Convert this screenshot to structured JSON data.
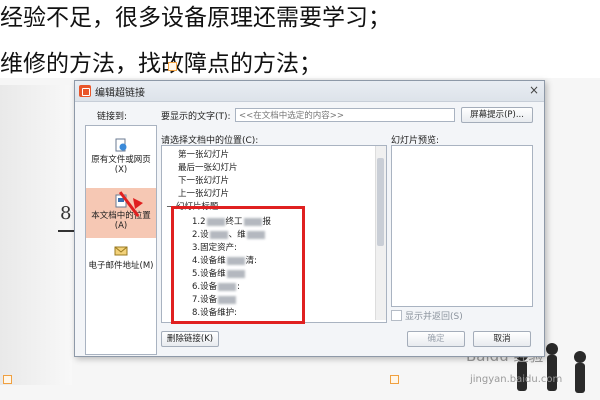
{
  "document": {
    "line1": "经验不足，很多设备原理还需要学习；",
    "line2": "维修的方法，找故障点的方法；",
    "slide_mark": "8"
  },
  "watermark": {
    "brand": "Baidu 经验",
    "url": "jingyan.baidu.com"
  },
  "dialog": {
    "title": "编辑超链接",
    "close_glyph": "×",
    "link_to_label": "链接到:",
    "display_text_label": "要显示的文字(T):",
    "display_text_value": "<<在文档中选定的内容>>",
    "screentip_button": "屏幕提示(P)...",
    "location_label": "请选择文档中的位置(C):",
    "preview_label": "幻灯片预览:",
    "show_return_label": "显示并返回(S)",
    "remove_link_button": "删除链接(K)",
    "ok_button": "确定",
    "cancel_button": "取消"
  },
  "leftnav": {
    "items": [
      {
        "label": "原有文件或网页(X)",
        "selected": false,
        "icon": "file-web-icon"
      },
      {
        "label": "本文档中的位置(A)",
        "selected": true,
        "icon": "document-location-icon"
      },
      {
        "label": "电子邮件地址(M)",
        "selected": false,
        "icon": "email-icon"
      }
    ]
  },
  "tree": {
    "items": [
      {
        "label": "第一张幻灯片"
      },
      {
        "label": "最后一张幻灯片"
      },
      {
        "label": "下一张幻灯片"
      },
      {
        "label": "上一张幻灯片"
      },
      {
        "label": "幻灯片标题"
      }
    ],
    "titles": [
      {
        "pre": "1.2",
        "post": "终工",
        "tail": "报"
      },
      {
        "pre": "2.设",
        "post": "、维",
        "tail": ""
      },
      {
        "pre": "3.固定资产:",
        "post": "",
        "tail": ""
      },
      {
        "pre": "4.设备维",
        "post": "清:",
        "tail": ""
      },
      {
        "pre": "5.设备维",
        "post": "",
        "tail": ""
      },
      {
        "pre": "6.设备",
        "post": ":",
        "tail": ""
      },
      {
        "pre": "7.设备",
        "post": "",
        "tail": ""
      },
      {
        "pre": "8.设备维护:",
        "post": "",
        "tail": ""
      }
    ]
  },
  "colors": {
    "highlight": "#e02020",
    "selected_nav": "#f6c8b4"
  }
}
